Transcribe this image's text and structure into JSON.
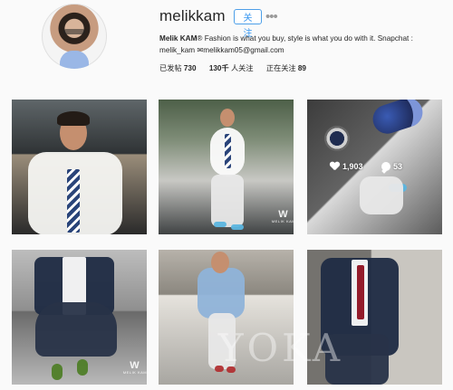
{
  "profile": {
    "username": "melikkam",
    "follow_label": "关注",
    "more_label": "•••",
    "bio_name": "Melik KAM",
    "bio_registered": "®",
    "bio_text": " Fashion is what you buy, style is what you do with it. Snapchat : melik_kam ",
    "bio_email": "melikkam05@gmail.com",
    "email_icon": "envelope-icon"
  },
  "stats": [
    {
      "label": "已发帖",
      "value": "730"
    },
    {
      "label": "人关注",
      "value": "130千"
    },
    {
      "label": "正在关注",
      "value": "89"
    }
  ],
  "posts": [
    {
      "watermark": ""
    },
    {
      "watermark": "W"
    },
    {
      "watermark": ""
    },
    {
      "watermark": "W"
    },
    {
      "watermark": ""
    },
    {
      "watermark": ""
    }
  ],
  "overlay": {
    "likes": "1,903",
    "comments": "53",
    "like_icon": "heart-icon",
    "comment_icon": "comment-icon"
  },
  "site_watermark": "YOKA"
}
